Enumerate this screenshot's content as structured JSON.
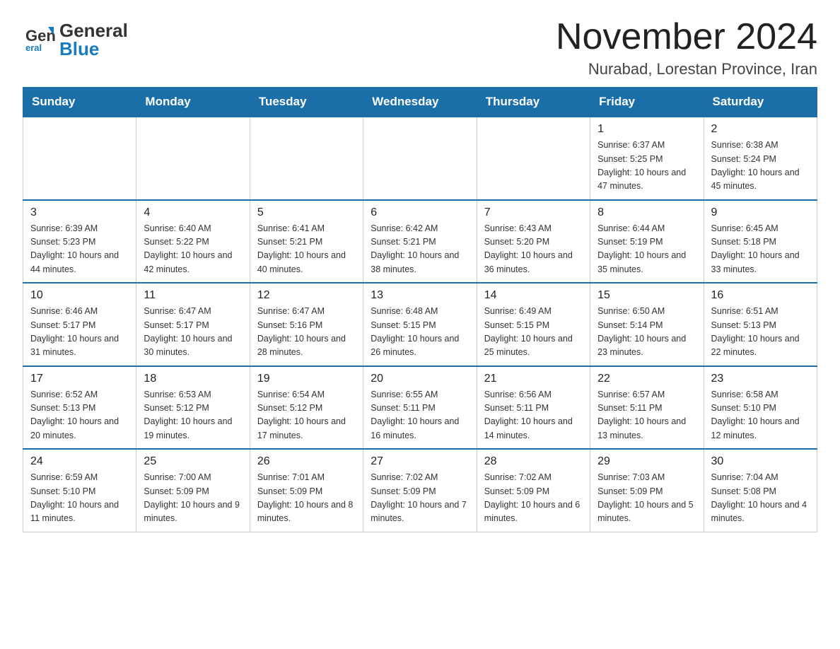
{
  "header": {
    "title": "November 2024",
    "subtitle": "Nurabad, Lorestan Province, Iran",
    "logo_general": "General",
    "logo_blue": "Blue"
  },
  "days_of_week": [
    "Sunday",
    "Monday",
    "Tuesday",
    "Wednesday",
    "Thursday",
    "Friday",
    "Saturday"
  ],
  "weeks": [
    {
      "days": [
        {
          "number": "",
          "info": ""
        },
        {
          "number": "",
          "info": ""
        },
        {
          "number": "",
          "info": ""
        },
        {
          "number": "",
          "info": ""
        },
        {
          "number": "",
          "info": ""
        },
        {
          "number": "1",
          "info": "Sunrise: 6:37 AM\nSunset: 5:25 PM\nDaylight: 10 hours and 47 minutes."
        },
        {
          "number": "2",
          "info": "Sunrise: 6:38 AM\nSunset: 5:24 PM\nDaylight: 10 hours and 45 minutes."
        }
      ]
    },
    {
      "days": [
        {
          "number": "3",
          "info": "Sunrise: 6:39 AM\nSunset: 5:23 PM\nDaylight: 10 hours and 44 minutes."
        },
        {
          "number": "4",
          "info": "Sunrise: 6:40 AM\nSunset: 5:22 PM\nDaylight: 10 hours and 42 minutes."
        },
        {
          "number": "5",
          "info": "Sunrise: 6:41 AM\nSunset: 5:21 PM\nDaylight: 10 hours and 40 minutes."
        },
        {
          "number": "6",
          "info": "Sunrise: 6:42 AM\nSunset: 5:21 PM\nDaylight: 10 hours and 38 minutes."
        },
        {
          "number": "7",
          "info": "Sunrise: 6:43 AM\nSunset: 5:20 PM\nDaylight: 10 hours and 36 minutes."
        },
        {
          "number": "8",
          "info": "Sunrise: 6:44 AM\nSunset: 5:19 PM\nDaylight: 10 hours and 35 minutes."
        },
        {
          "number": "9",
          "info": "Sunrise: 6:45 AM\nSunset: 5:18 PM\nDaylight: 10 hours and 33 minutes."
        }
      ]
    },
    {
      "days": [
        {
          "number": "10",
          "info": "Sunrise: 6:46 AM\nSunset: 5:17 PM\nDaylight: 10 hours and 31 minutes."
        },
        {
          "number": "11",
          "info": "Sunrise: 6:47 AM\nSunset: 5:17 PM\nDaylight: 10 hours and 30 minutes."
        },
        {
          "number": "12",
          "info": "Sunrise: 6:47 AM\nSunset: 5:16 PM\nDaylight: 10 hours and 28 minutes."
        },
        {
          "number": "13",
          "info": "Sunrise: 6:48 AM\nSunset: 5:15 PM\nDaylight: 10 hours and 26 minutes."
        },
        {
          "number": "14",
          "info": "Sunrise: 6:49 AM\nSunset: 5:15 PM\nDaylight: 10 hours and 25 minutes."
        },
        {
          "number": "15",
          "info": "Sunrise: 6:50 AM\nSunset: 5:14 PM\nDaylight: 10 hours and 23 minutes."
        },
        {
          "number": "16",
          "info": "Sunrise: 6:51 AM\nSunset: 5:13 PM\nDaylight: 10 hours and 22 minutes."
        }
      ]
    },
    {
      "days": [
        {
          "number": "17",
          "info": "Sunrise: 6:52 AM\nSunset: 5:13 PM\nDaylight: 10 hours and 20 minutes."
        },
        {
          "number": "18",
          "info": "Sunrise: 6:53 AM\nSunset: 5:12 PM\nDaylight: 10 hours and 19 minutes."
        },
        {
          "number": "19",
          "info": "Sunrise: 6:54 AM\nSunset: 5:12 PM\nDaylight: 10 hours and 17 minutes."
        },
        {
          "number": "20",
          "info": "Sunrise: 6:55 AM\nSunset: 5:11 PM\nDaylight: 10 hours and 16 minutes."
        },
        {
          "number": "21",
          "info": "Sunrise: 6:56 AM\nSunset: 5:11 PM\nDaylight: 10 hours and 14 minutes."
        },
        {
          "number": "22",
          "info": "Sunrise: 6:57 AM\nSunset: 5:11 PM\nDaylight: 10 hours and 13 minutes."
        },
        {
          "number": "23",
          "info": "Sunrise: 6:58 AM\nSunset: 5:10 PM\nDaylight: 10 hours and 12 minutes."
        }
      ]
    },
    {
      "days": [
        {
          "number": "24",
          "info": "Sunrise: 6:59 AM\nSunset: 5:10 PM\nDaylight: 10 hours and 11 minutes."
        },
        {
          "number": "25",
          "info": "Sunrise: 7:00 AM\nSunset: 5:09 PM\nDaylight: 10 hours and 9 minutes."
        },
        {
          "number": "26",
          "info": "Sunrise: 7:01 AM\nSunset: 5:09 PM\nDaylight: 10 hours and 8 minutes."
        },
        {
          "number": "27",
          "info": "Sunrise: 7:02 AM\nSunset: 5:09 PM\nDaylight: 10 hours and 7 minutes."
        },
        {
          "number": "28",
          "info": "Sunrise: 7:02 AM\nSunset: 5:09 PM\nDaylight: 10 hours and 6 minutes."
        },
        {
          "number": "29",
          "info": "Sunrise: 7:03 AM\nSunset: 5:09 PM\nDaylight: 10 hours and 5 minutes."
        },
        {
          "number": "30",
          "info": "Sunrise: 7:04 AM\nSunset: 5:08 PM\nDaylight: 10 hours and 4 minutes."
        }
      ]
    }
  ]
}
